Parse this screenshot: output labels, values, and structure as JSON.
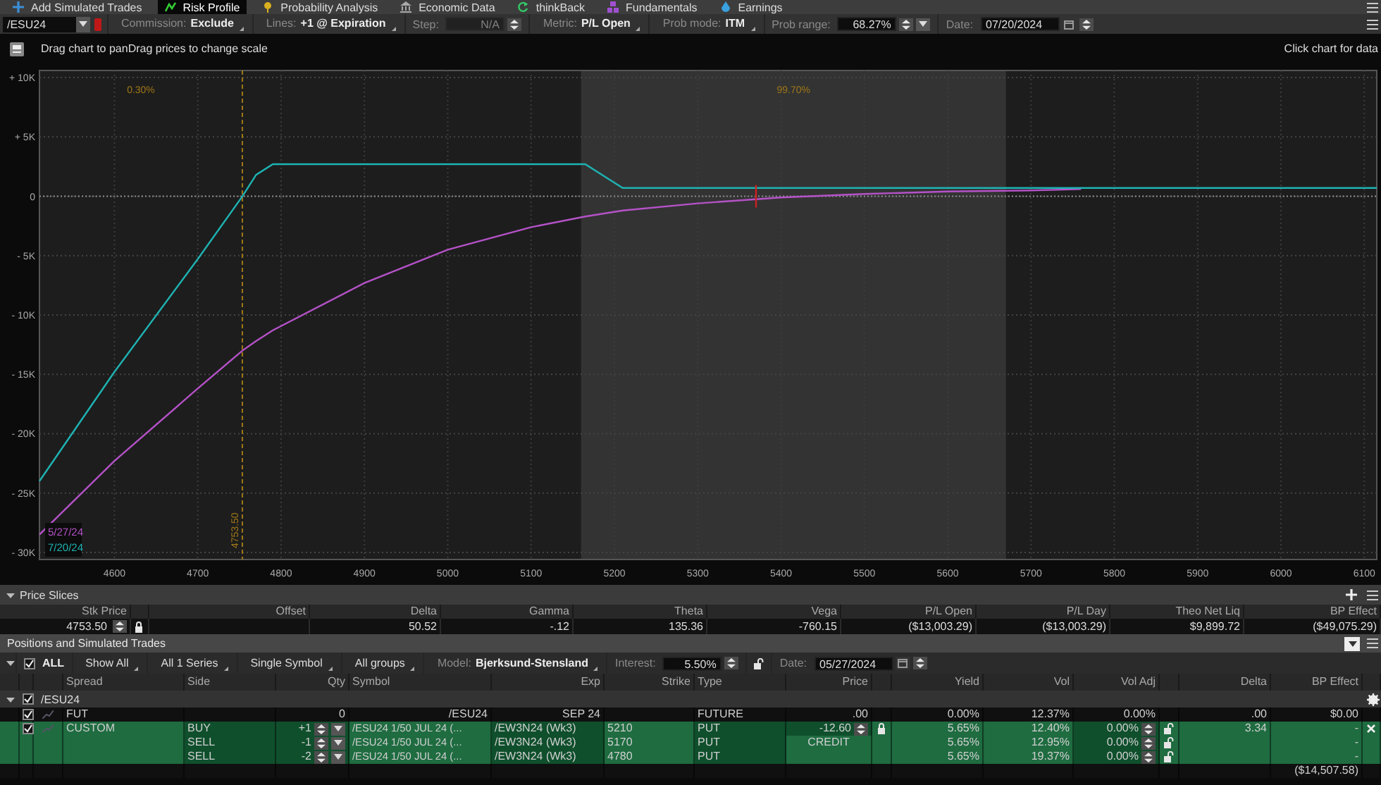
{
  "tabs": [
    {
      "label": "Add Simulated Trades",
      "selected": false
    },
    {
      "label": "Risk Profile",
      "selected": true
    },
    {
      "label": "Probability Analysis",
      "selected": false
    },
    {
      "label": "Economic Data",
      "selected": false
    },
    {
      "label": "thinkBack",
      "selected": false
    },
    {
      "label": "Fundamentals",
      "selected": false
    },
    {
      "label": "Earnings",
      "selected": false
    }
  ],
  "settings": {
    "symbol": "/ESU24",
    "items": [
      {
        "kind": "dropdown",
        "label": "Commission:",
        "value": "Exclude",
        "disabled": false
      },
      {
        "kind": "dropdown",
        "label": "Lines:",
        "value": "+1 @ Expiration",
        "disabled": false
      },
      {
        "kind": "spin",
        "label": "Step:",
        "value": "N/A",
        "disabled": true,
        "menu": false
      },
      {
        "kind": "dropdown",
        "label": "Metric:",
        "value": "P/L Open",
        "disabled": false
      },
      {
        "kind": "dropdown",
        "label": "Prob mode:",
        "value": "ITM",
        "disabled": false
      },
      {
        "kind": "spin",
        "label": "Prob range:",
        "value": "68.27%",
        "disabled": false,
        "menu": true
      },
      {
        "kind": "date",
        "label": "Date:",
        "value": "07/20/2024",
        "disabled": false
      }
    ]
  },
  "info_bar": {
    "hint": "Drag chart to panDrag prices to change scale",
    "action": "Click chart for data"
  },
  "chart": {
    "chart_data": {
      "type": "line",
      "x": [
        4510,
        4600,
        4700,
        4753.5,
        4770,
        4790,
        4900,
        5000,
        5100,
        5165,
        5210,
        5300,
        5400,
        5500,
        5600,
        5700,
        5760,
        5800,
        5900,
        6000,
        6100,
        6115
      ],
      "series": [
        {
          "name": "5/27/24",
          "color": "#b552c8",
          "values": [
            -28500,
            -22300,
            -16200,
            -13000,
            -12200,
            -11300,
            -7300,
            -4500,
            -2600,
            -1700,
            -1200,
            -600,
            -100,
            200,
            400,
            500,
            600,
            null,
            null,
            null,
            null,
            null
          ]
        },
        {
          "name": "7/20/24",
          "color": "#1fb3b3",
          "values": [
            -24000,
            -14800,
            -5300,
            0,
            1800,
            2700,
            2700,
            2700,
            2700,
            2700,
            700,
            700,
            700,
            700,
            700,
            700,
            700,
            700,
            700,
            700,
            700,
            700
          ]
        }
      ],
      "xlim": [
        4510,
        6115
      ],
      "ylim": [
        -30600,
        10600
      ],
      "xticks": [
        4600,
        4700,
        4800,
        4900,
        5000,
        5100,
        5200,
        5300,
        5400,
        5500,
        5600,
        5700,
        5800,
        5900,
        6000,
        6100
      ],
      "yticks": [
        {
          "value": 10000,
          "label": "+ 10K"
        },
        {
          "value": 5000,
          "label": "+ 5K"
        },
        {
          "value": 0,
          "label": "0"
        },
        {
          "value": -5000,
          "label": "- 5K"
        },
        {
          "value": -10000,
          "label": "- 10K"
        },
        {
          "value": -15000,
          "label": "- 15K"
        },
        {
          "value": -20000,
          "label": "- 20K"
        },
        {
          "value": -25000,
          "label": "- 25K"
        },
        {
          "value": -30000,
          "label": "- 30K"
        }
      ],
      "grid": true,
      "ref_lines": [
        {
          "axis": "y",
          "value": 0
        },
        {
          "axis": "x",
          "value": 4753.5,
          "label": "4753.50"
        }
      ],
      "annotations": [
        "0.30%",
        "99.70%"
      ]
    }
  },
  "price_slices": {
    "title": "Price Slices",
    "expanded": true,
    "columns": [
      {
        "label": "Stk Price",
        "value": "4753.50"
      },
      {
        "label": "Offset"
      },
      {
        "label": "Delta",
        "value": "50.52"
      },
      {
        "label": "Gamma",
        "value": "-.12"
      },
      {
        "label": "Theta",
        "value": "135.36"
      },
      {
        "label": "Vega",
        "value": "-760.15"
      },
      {
        "label": "P/L Open",
        "value": "($13,003.29)"
      },
      {
        "label": "P/L Day",
        "value": "($13,003.29)"
      },
      {
        "label": "Theo Net Liq",
        "value": "$9,899.72"
      },
      {
        "label": "BP Effect",
        "value": "($49,075.29)"
      }
    ]
  },
  "positions": {
    "title": "Positions and Simulated Trades",
    "expanded": true,
    "filters": [
      {
        "kind": "check",
        "label": "ALL",
        "checked": true
      },
      {
        "kind": "dropdown",
        "value": "Show All"
      },
      {
        "kind": "dropdown",
        "value": "All 1 Series"
      },
      {
        "kind": "dropdown",
        "value": "Single Symbol"
      },
      {
        "kind": "dropdown",
        "value": "All groups"
      },
      {
        "kind": "dropdown",
        "label": "Model:",
        "value": "Bjerksund-Stensland"
      },
      {
        "kind": "spin",
        "label": "Interest:",
        "value": "5.50%",
        "menu": false
      },
      {
        "kind": "lock"
      },
      {
        "kind": "date",
        "label": "Date:",
        "value": "05/27/2024"
      }
    ],
    "columns": [
      "Spread",
      "Side",
      "Qty",
      "Symbol",
      "Exp",
      "Strike",
      "Type",
      "Price",
      "Yield",
      "Vol",
      "Vol Adj",
      "Delta",
      "BP Effect"
    ],
    "groups": [
      {
        "symbol": "/ESU24",
        "checked": true,
        "expanded": true,
        "positions": [
          {
            "spread": "FUT",
            "checked": true,
            "simulated": false,
            "legs": [
              {
                "qty": "0",
                "symbol": "/ESU24",
                "exp": "SEP 24",
                "type": "FUTURE",
                "price": ".00",
                "yield": "0.00%",
                "vol": "12.37%",
                "vol_adj": "0.00%",
                "delta": ".00",
                "bp_effect": "$0.00"
              }
            ]
          },
          {
            "spread": "CUSTOM",
            "checked": true,
            "simulated": true,
            "legs": [
              {
                "side": "BUY",
                "qty": "+1",
                "symbol": "/ESU24 1/50 JUL 24 (...",
                "exp": "/EW3N24 (Wk3)",
                "strike": "5210",
                "type": "PUT",
                "price": "-12.60",
                "yield": "5.65%",
                "vol": "12.40%",
                "vol_adj": "0.00%",
                "delta": "3.34",
                "bp_effect": "-"
              },
              {
                "side": "SELL",
                "qty": "-1",
                "symbol": "/ESU24 1/50 JUL 24 (...",
                "exp": "/EW3N24 (Wk3)",
                "strike": "5170",
                "type": "PUT",
                "price": "CREDIT",
                "yield": "5.65%",
                "vol": "12.95%",
                "vol_adj": "0.00%",
                "bp_effect": "-"
              },
              {
                "side": "SELL",
                "qty": "-2",
                "symbol": "/ESU24 1/50 JUL 24 (...",
                "exp": "/EW3N24 (Wk3)",
                "strike": "4780",
                "type": "PUT",
                "yield": "5.65%",
                "vol": "19.37%",
                "vol_adj": "0.00%",
                "bp_effect": "-"
              }
            ]
          }
        ]
      }
    ],
    "total": {
      "bp_effect": "($14,507.58)"
    }
  }
}
